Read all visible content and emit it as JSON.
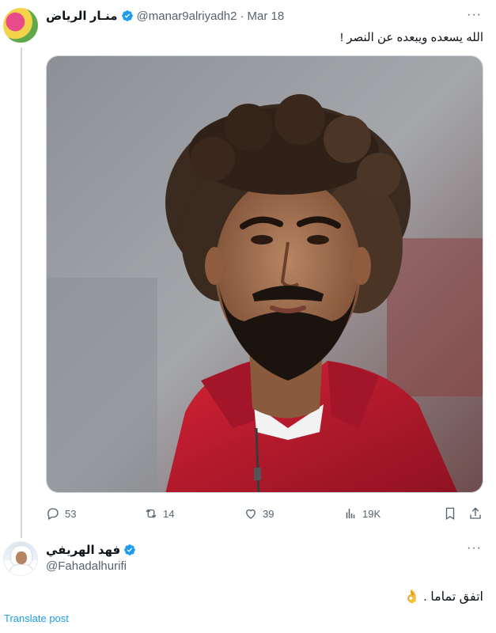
{
  "tweet1": {
    "name": "منـار الرياض",
    "handle": "@manar9alriyadh2",
    "separator": "·",
    "date": "Mar 18",
    "text": "الله يسعده ويبعده عن النصر !",
    "more": "···",
    "stats": {
      "replies": "53",
      "reposts": "14",
      "likes": "39",
      "views": "19K"
    }
  },
  "tweet2": {
    "name": "فهد الهريفي",
    "handle": "@Fahadalhurifi",
    "text": "اتفق تماما .",
    "emoji": "👌",
    "more": "···"
  },
  "translate_link": "Translate post",
  "colors": {
    "accent": "#1d9bf0",
    "muted": "#536471",
    "text": "#0f1419",
    "jersey": "#c8102e"
  }
}
